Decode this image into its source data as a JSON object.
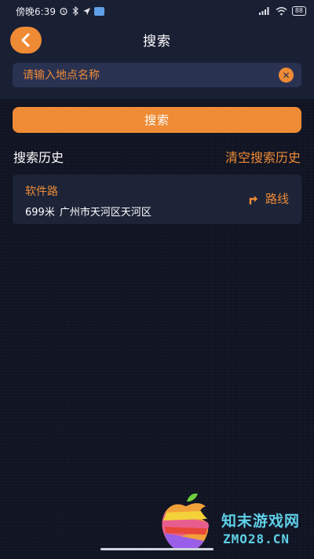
{
  "status_bar": {
    "time": "傍晚6:39",
    "battery": "88"
  },
  "header": {
    "title": "搜索"
  },
  "search": {
    "placeholder": "请输入地点名称",
    "value": "",
    "button_label": "搜索"
  },
  "history": {
    "title": "搜索历史",
    "clear_label": "清空搜索历史",
    "items": [
      {
        "name": "软件路",
        "distance": "699米",
        "address": "广州市天河区天河区",
        "route_label": "路线"
      }
    ]
  },
  "watermark": {
    "cn": "知末游戏网",
    "en": "ZMO28.CN"
  },
  "colors": {
    "accent": "#ef8b35",
    "background": "#0f1322",
    "header_bg": "#1a2034",
    "input_bg": "#2a3252",
    "card_bg": "#1d2438"
  }
}
